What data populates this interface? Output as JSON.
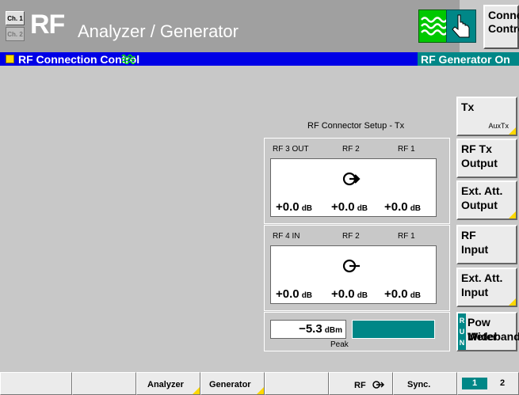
{
  "titlebar": {
    "ch1": "Ch. 1",
    "ch2": "Ch. 2",
    "rf": "RF",
    "subtitle": "Analyzer / Generator",
    "connect": [
      "Connect.",
      "Control"
    ]
  },
  "header": {
    "title": "RF Connection Control",
    "status": "RF Generator On"
  },
  "main": {
    "setup_label": "RF Connector Setup - Tx",
    "tx_panel": {
      "labels": [
        "RF 3 OUT",
        "RF 2",
        "RF 1"
      ],
      "values": [
        "+0.0",
        "+0.0",
        "+0.0"
      ],
      "unit": "dB"
    },
    "rx_panel": {
      "labels": [
        "RF 4 IN",
        "RF 2",
        "RF 1"
      ],
      "values": [
        "+0.0",
        "+0.0",
        "+0.0"
      ],
      "unit": "dB"
    },
    "power": {
      "value": "−5.3",
      "unit": "dBm",
      "label": "Peak"
    }
  },
  "side_buttons": {
    "tx": {
      "label": "Tx",
      "sub": "AuxTx"
    },
    "rf_tx_output": [
      "RF Tx",
      "Output"
    ],
    "ext_att_output": [
      "Ext. Att.",
      "Output"
    ],
    "rf_input": [
      "RF",
      "Input"
    ],
    "ext_att_input": [
      "Ext. Att.",
      "Input"
    ],
    "run_letters": [
      "R",
      "U",
      "N"
    ],
    "pow_meter": [
      "Pow Meter",
      "Wideband"
    ]
  },
  "bottom": {
    "analyzer": "Analyzer",
    "generator": "Generator",
    "rf": "RF",
    "sync": "Sync.",
    "page1": "1",
    "page2": "2"
  },
  "colors": {
    "teal": "#008787",
    "blue": "#0000e6",
    "yellow": "#ffd800",
    "green": "#00c800"
  }
}
